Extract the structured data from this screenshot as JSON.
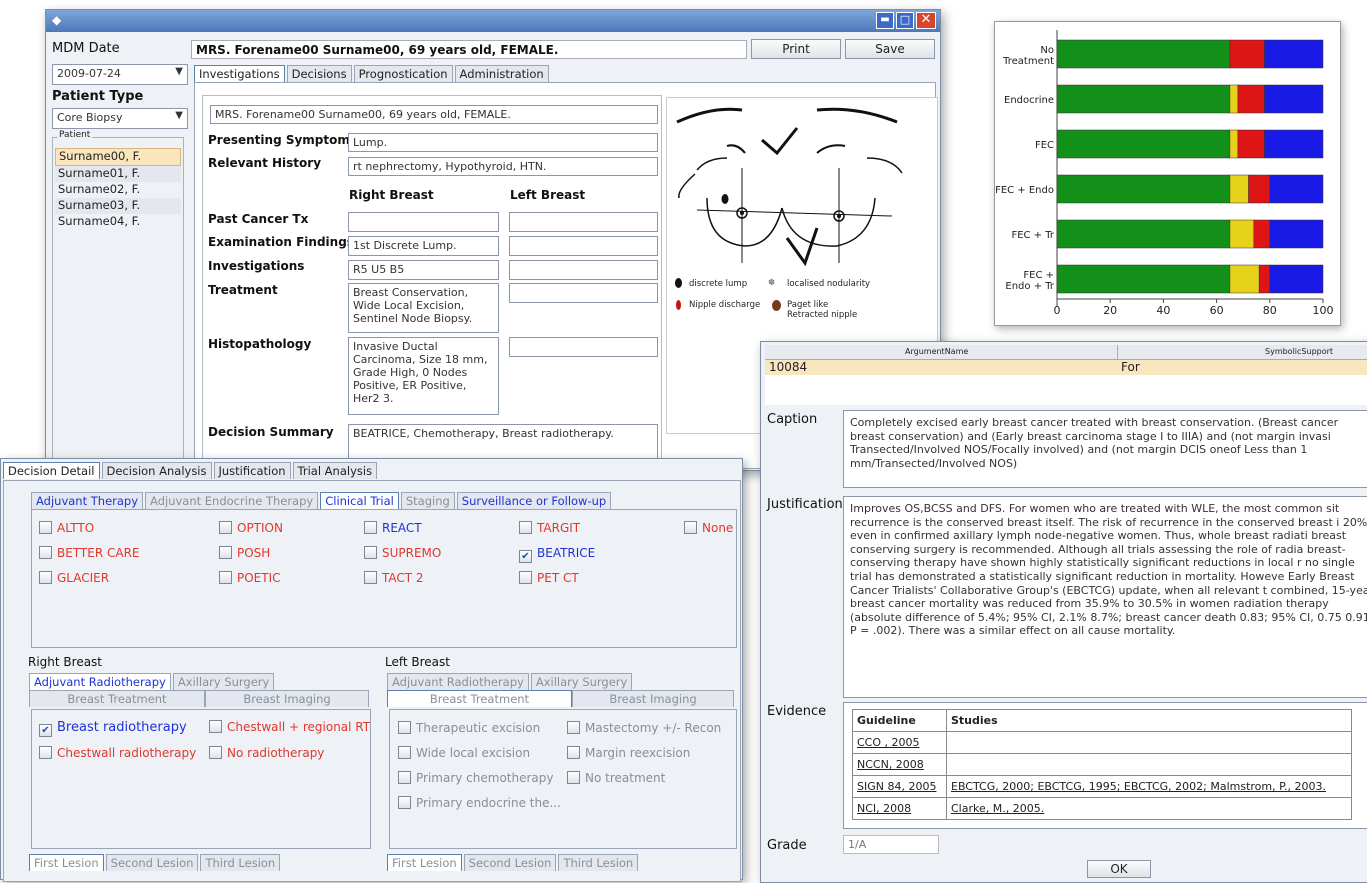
{
  "colors": {
    "green": "#12901a",
    "yellow": "#e6d21a",
    "red": "#dd1515",
    "blue": "#1a1ae6",
    "titlebar": "#5b86c4"
  },
  "main_window": {
    "mdm_date_label": "MDM Date",
    "mdm_date_value": "2009-07-24",
    "patient_type_label": "Patient Type",
    "patient_type_value": "Core Biopsy",
    "patient_group_label": "Patient",
    "patients": [
      "Surname00, F.",
      "Surname01, F.",
      "Surname02, F.",
      "Surname03, F.",
      "Surname04, F."
    ],
    "header_text": "MRS. Forename00 Surname00, 69 years old, FEMALE.",
    "print_label": "Print",
    "save_label": "Save",
    "tabs": [
      "Investigations",
      "Decisions",
      "Prognostication",
      "Administration"
    ],
    "patient_line": "MRS. Forename00 Surname00, 69 years old, FEMALE.",
    "presenting_label": "Presenting Symptoms",
    "presenting_value": "Lump.",
    "history_label": "Relevant History",
    "history_value": "rt nephrectomy, Hypothyroid, HTN.",
    "right_breast_header": "Right Breast",
    "left_breast_header": "Left Breast",
    "past_tx_label": "Past Cancer Tx",
    "exam_label": "Examination Findings",
    "exam_right": "1st Discrete Lump.",
    "investigations_label": "Investigations",
    "investigations_right": "R5 U5 B5",
    "treatment_label": "Treatment",
    "treatment_right": "Breast Conservation, Wide Local Excision, Sentinel Node Biopsy.",
    "histo_label": "Histopathology",
    "histo_right": "Invasive Ductal Carcinoma, Size 18 mm, Grade High, 0 Nodes Positive, ER Positive, Her2 3.",
    "decision_summary_label": "Decision Summary",
    "decision_summary_value": "BEATRICE, Chemotherapy, Breast radiotherapy.",
    "legend": {
      "discrete": "discrete lump",
      "nodularity": "localised nodularity",
      "nipple": "Nipple discharge",
      "paget": "Paget like",
      "retracted": "Retracted nipple"
    }
  },
  "chart_data": {
    "type": "bar",
    "orientation": "horizontal-stacked",
    "categories": [
      "No Treatment",
      "Endocrine",
      "FEC",
      "FEC + Endo",
      "FEC + Tr",
      "FEC + Endo + Tr"
    ],
    "series": [
      {
        "color": "#12901a",
        "values": [
          65,
          65,
          65,
          65,
          65,
          65
        ]
      },
      {
        "color": "#e6d21a",
        "values": [
          0,
          3,
          3,
          7,
          9,
          11
        ]
      },
      {
        "color": "#dd1515",
        "values": [
          13,
          10,
          10,
          8,
          6,
          4
        ]
      },
      {
        "color": "#1a1ae6",
        "values": [
          22,
          22,
          22,
          20,
          20,
          20
        ]
      }
    ],
    "xlim": [
      0,
      100
    ],
    "xticks": [
      "0",
      "20",
      "40",
      "60",
      "80",
      "100"
    ]
  },
  "decision_window": {
    "tabs": [
      "Decision Detail",
      "Decision Analysis",
      "Justification",
      "Trial Analysis"
    ],
    "subtabs": [
      "Adjuvant Therapy",
      "Adjuvant Endocrine Therapy",
      "Clinical Trial",
      "Staging",
      "Surveillance or Follow-up"
    ],
    "trials": [
      {
        "label": "ALTTO",
        "checked": false
      },
      {
        "label": "OPTION",
        "checked": false
      },
      {
        "label": "REACT",
        "checked": false
      },
      {
        "label": "TARGIT",
        "checked": false
      },
      {
        "label": "None",
        "checked": false
      },
      {
        "label": "BETTER CARE",
        "checked": false
      },
      {
        "label": "POSH",
        "checked": false
      },
      {
        "label": "SUPREMO",
        "checked": false
      },
      {
        "label": "BEATRICE",
        "checked": true
      },
      {
        "label": "GLACIER",
        "checked": false
      },
      {
        "label": "POETIC",
        "checked": false
      },
      {
        "label": "TACT 2",
        "checked": false
      },
      {
        "label": "PET CT",
        "checked": false
      }
    ],
    "right_breast": "Right Breast",
    "left_breast": "Left Breast",
    "rb_tabs": [
      "Adjuvant Radiotherapy",
      "Axillary Surgery"
    ],
    "rb_subtabs": [
      "Breast Treatment",
      "Breast Imaging"
    ],
    "rb_options": [
      "Breast radiotherapy",
      "Chestwall + regional RT",
      "Chestwall radiotherapy",
      "No radiotherapy"
    ],
    "lb_tabs": [
      "Adjuvant Radiotherapy",
      "Axillary Surgery"
    ],
    "lb_subtabs": [
      "Breast Treatment",
      "Breast Imaging"
    ],
    "lb_options": [
      "Therapeutic excision",
      "Mastectomy +/- Recon",
      "Wide local excision",
      "Margin reexcision",
      "Primary chemotherapy",
      "No treatment",
      "Primary endocrine the..."
    ],
    "lesion_tabs": [
      "First Lesion",
      "Second Lesion",
      "Third Lesion"
    ]
  },
  "argument_window": {
    "col_argument": "ArgumentName",
    "col_support": "SymbolicSupport",
    "row_id": "10084",
    "row_support": "For",
    "caption_label": "Caption",
    "caption_text": "Completely excised early breast cancer treated with breast conservation. (Breast cancer breast conservation) and (Early breast carcinoma stage I to IIIA) and (not margin invasi Transected/Involved NOS/Focally involved) and (not margin DCIS oneof Less than 1 mm/Transected/Involved NOS)",
    "justification_label": "Justification",
    "justification_text": "Improves OS,BCSS and DFS. For women who are treated with WLE, the most common sit recurrence is the conserved breast itself. The risk of recurrence in the conserved breast i 20%) even in confirmed axillary lymph node-negative women. Thus, whole breast radiati breast conserving surgery is recommended. Although all trials assessing the role of radia breast-conserving therapy have shown highly statistically significant reductions in local r no single trial has demonstrated a statistically significant reduction in mortality. Howeve Early Breast Cancer Trialists' Collaborative Group's (EBCTCG) update, when all relevant t combined, 15-year breast cancer mortality was reduced from 35.9% to 30.5% in women radiation therapy (absolute difference of 5.4%; 95% CI, 2.1% 8.7%; breast cancer death 0.83; 95% CI, 0.75 0.91; P = .002). There was a similar effect on all cause mortality.",
    "evidence_label": "Evidence",
    "evidence_head": [
      "Guideline",
      "Studies"
    ],
    "evidence_rows": [
      {
        "g": "CCO , 2005",
        "s": ""
      },
      {
        "g": "NCCN, 2008",
        "s": ""
      },
      {
        "g": "SIGN 84, 2005",
        "s": "EBCTCG, 2000; EBCTCG, 1995; EBCTCG, 2002; Malmstrom, P., 2003."
      },
      {
        "g": "NCI, 2008",
        "s": "Clarke, M., 2005."
      }
    ],
    "grade_label": "Grade",
    "grade_value": "1/A",
    "ok_label": "OK"
  }
}
